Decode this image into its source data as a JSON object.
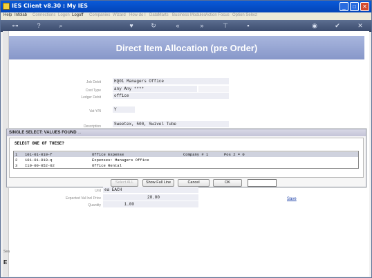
{
  "window": {
    "title": "IES Client v8.30 : My IES",
    "buttons": {
      "minimize": "_",
      "maximize": "□",
      "close": "✕"
    }
  },
  "menubar": {
    "items": [
      "Help",
      "Infolab",
      "Connections",
      "Logon",
      "Logoff",
      "Companies",
      "Wizard",
      "How do I",
      "DataMarts",
      "Business Modules",
      "Action Focus",
      "Option Select"
    ],
    "enabled": [
      "Help",
      "Infolab",
      "Logoff"
    ]
  },
  "toolbar": {
    "icons": [
      "key-icon",
      "help-icon",
      "search-icon",
      "heart-icon",
      "refresh-icon",
      "rewind-icon",
      "fast-forward-icon",
      "stop-icon",
      "page-icon",
      "globe-icon",
      "check-icon",
      "close-icon"
    ]
  },
  "page": {
    "title": "Direct Item Allocation (pre Order)"
  },
  "form": {
    "job_debit": {
      "label": "Job Debit",
      "value": "HQ01 Managers Office"
    },
    "cost_type": {
      "label": "Cost Type",
      "value": "any Any ****"
    },
    "ledger_debit": {
      "label": "Ledger Debit",
      "value": "office"
    },
    "vat": {
      "label": "Vat Y/N",
      "value": "Y"
    },
    "description": {
      "label": "Description",
      "value": "Sweetex, 500, Swivel Tube"
    },
    "unit": {
      "label": "Unit",
      "value": "ea EACH"
    },
    "expected_price": {
      "label": "Expected Val Incl Price",
      "value": "20.00"
    },
    "quantity": {
      "label": "Quantity",
      "value": "1.00"
    },
    "save_label": "Save"
  },
  "dialog": {
    "title": "SINGLE SELECT: VALUES FOUND",
    "title_suffix": "...",
    "prompt": "SELECT ONE OF THESE?",
    "rows": [
      {
        "num": "1",
        "code": "101-01-010-f",
        "name": "Office Expense",
        "company": "Company # 1",
        "pos": "Pos 2 = 0",
        "selected": true
      },
      {
        "num": "2",
        "code": "101-01-010-q",
        "name": "Expenses: Managers Office",
        "company": "",
        "pos": "",
        "selected": false
      },
      {
        "num": "3",
        "code": "I10-00-052-02",
        "name": "Office Rental",
        "company": "",
        "pos": "",
        "selected": false
      }
    ],
    "buttons": {
      "select_all": "Select ALL",
      "show_full_line": "Show Full Line",
      "cancel": "Cancel",
      "ok": "OK"
    },
    "lookup_value": ""
  },
  "leftstrip": {
    "items": [
      "Sea",
      "E"
    ]
  }
}
